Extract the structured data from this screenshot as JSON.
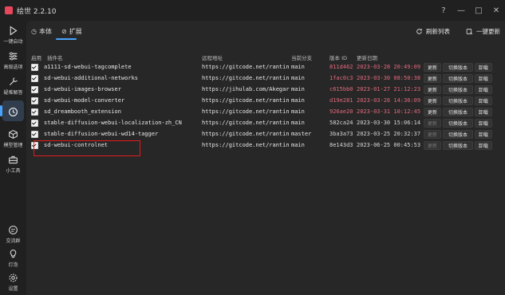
{
  "window": {
    "title": "绘世 2.2.10",
    "controls": [
      "?",
      "—",
      "□",
      "✕"
    ]
  },
  "sidebar": {
    "items": [
      {
        "label": "一键启动",
        "icon": "play-icon"
      },
      {
        "label": "高级选项",
        "icon": "sliders-icon"
      },
      {
        "label": "疑难解答",
        "icon": "wrench-icon"
      },
      {
        "label": "",
        "icon": "history-icon",
        "active": true
      },
      {
        "label": "模型管理",
        "icon": "cube-icon"
      },
      {
        "label": "小工具",
        "icon": "toolbox-icon"
      },
      {
        "label": "交流群",
        "icon": "chat-icon"
      },
      {
        "label": "灯泡",
        "icon": "bulb-icon"
      },
      {
        "label": "设置",
        "icon": "gear-icon"
      }
    ]
  },
  "tabs": [
    {
      "label": "本体",
      "icon": "clock-icon"
    },
    {
      "label": "扩展",
      "icon": "link-icon",
      "active": true
    }
  ],
  "actions": {
    "refresh": "刷新列表",
    "update_all": "一键更新"
  },
  "table": {
    "headers": {
      "enabled": "启用",
      "name": "插件名",
      "url": "远程地址",
      "branch": "当前分支",
      "version": "版本 ID",
      "date": "更新日期"
    },
    "buttons": {
      "update": "更新",
      "switch": "切换版本",
      "uninstall": "卸载"
    },
    "rows": [
      {
        "name": "a1111-sd-webui-tagcomplete",
        "url": "https://gitcode.net/rantin",
        "branch": "main",
        "version": "811d462",
        "date": "2023-03-28 20:49:09",
        "outdated": true
      },
      {
        "name": "sd-webui-additional-networks",
        "url": "https://gitcode.net/rantin",
        "branch": "main",
        "version": "1fac0c3",
        "date": "2023-03-30 08:50:38",
        "outdated": true
      },
      {
        "name": "sd-webui-images-browser",
        "url": "https://jihulab.com/Akegar",
        "branch": "main",
        "version": "c615bb0",
        "date": "2023-01-27 21:12:23",
        "outdated": true
      },
      {
        "name": "sd-webui-model-converter",
        "url": "https://gitcode.net/rantin",
        "branch": "main",
        "version": "d19e281",
        "date": "2023-03-26 14:36:09",
        "outdated": true
      },
      {
        "name": "sd_dreambooth_extension",
        "url": "https://gitcode.net/rantin",
        "branch": "main",
        "version": "926ae20",
        "date": "2023-03-31 10:12:45",
        "outdated": true
      },
      {
        "name": "stable-diffusion-webui-localization-zh_CN",
        "url": "https://gitcode.net/rantin",
        "branch": "main",
        "version": "582ca24",
        "date": "2023-03-30 15:06:14",
        "outdated": false
      },
      {
        "name": "stable-diffusion-webui-wd14-tagger",
        "url": "https://gitcode.net/rantin",
        "branch": "master",
        "version": "3ba3a73",
        "date": "2023-03-25 20:32:37",
        "outdated": false
      },
      {
        "name": "sd-webui-controlnet",
        "url": "https://gitcode.net/rantin",
        "branch": "main",
        "version": "8e143d3",
        "date": "2023-06-25 00:45:53",
        "outdated": false
      }
    ]
  },
  "colors": {
    "accent": "#4aa3ff",
    "outdated": "#e16a7c",
    "highlight": "#e01b1b"
  }
}
